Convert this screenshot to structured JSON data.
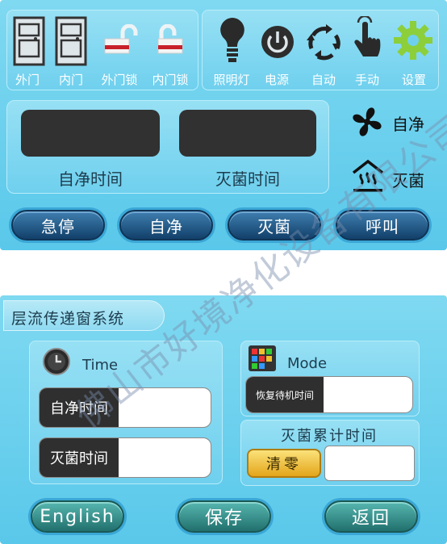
{
  "top_panel": {
    "icons": [
      {
        "label": "外门",
        "icon": "door-icon"
      },
      {
        "label": "内门",
        "icon": "door-icon"
      },
      {
        "label": "外门锁",
        "icon": "unlock-icon"
      },
      {
        "label": "内门锁",
        "icon": "unlock-icon"
      },
      {
        "label": "照明灯",
        "icon": "light-bulb-icon"
      },
      {
        "label": "电源",
        "icon": "power-icon"
      },
      {
        "label": "自动",
        "icon": "refresh-cycle-icon"
      },
      {
        "label": "手动",
        "icon": "hand-touch-icon"
      },
      {
        "label": "设置",
        "icon": "gear-icon"
      }
    ],
    "display_labels": {
      "self_clean_time": "自净时间",
      "sterilize_time": "灭菌时间"
    },
    "status": {
      "self_clean": "自净",
      "sterilize": "灭菌"
    },
    "buttons": {
      "stop": "急停",
      "self_clean": "自净",
      "sterilize": "灭菌",
      "call": "呼叫"
    }
  },
  "watermark": "佛山市好境净化设备有限公司",
  "settings_panel": {
    "title": "层流传递窗系统",
    "time": {
      "header": "Time",
      "self_clean_label": "自净时间",
      "self_clean_value": "",
      "sterilize_label": "灭菌时间",
      "sterilize_value": ""
    },
    "mode": {
      "header": "Mode",
      "restore_label": "恢复待机时间",
      "restore_value": ""
    },
    "cumulative": {
      "header": "灭菌累计时间",
      "clear_label": "清零",
      "value": ""
    },
    "buttons": {
      "english": "English",
      "save": "保存",
      "back": "返回"
    }
  },
  "colors": {
    "panel": "#6fd0ee",
    "dark": "#313131",
    "accent_gold": "#f2c12e"
  }
}
